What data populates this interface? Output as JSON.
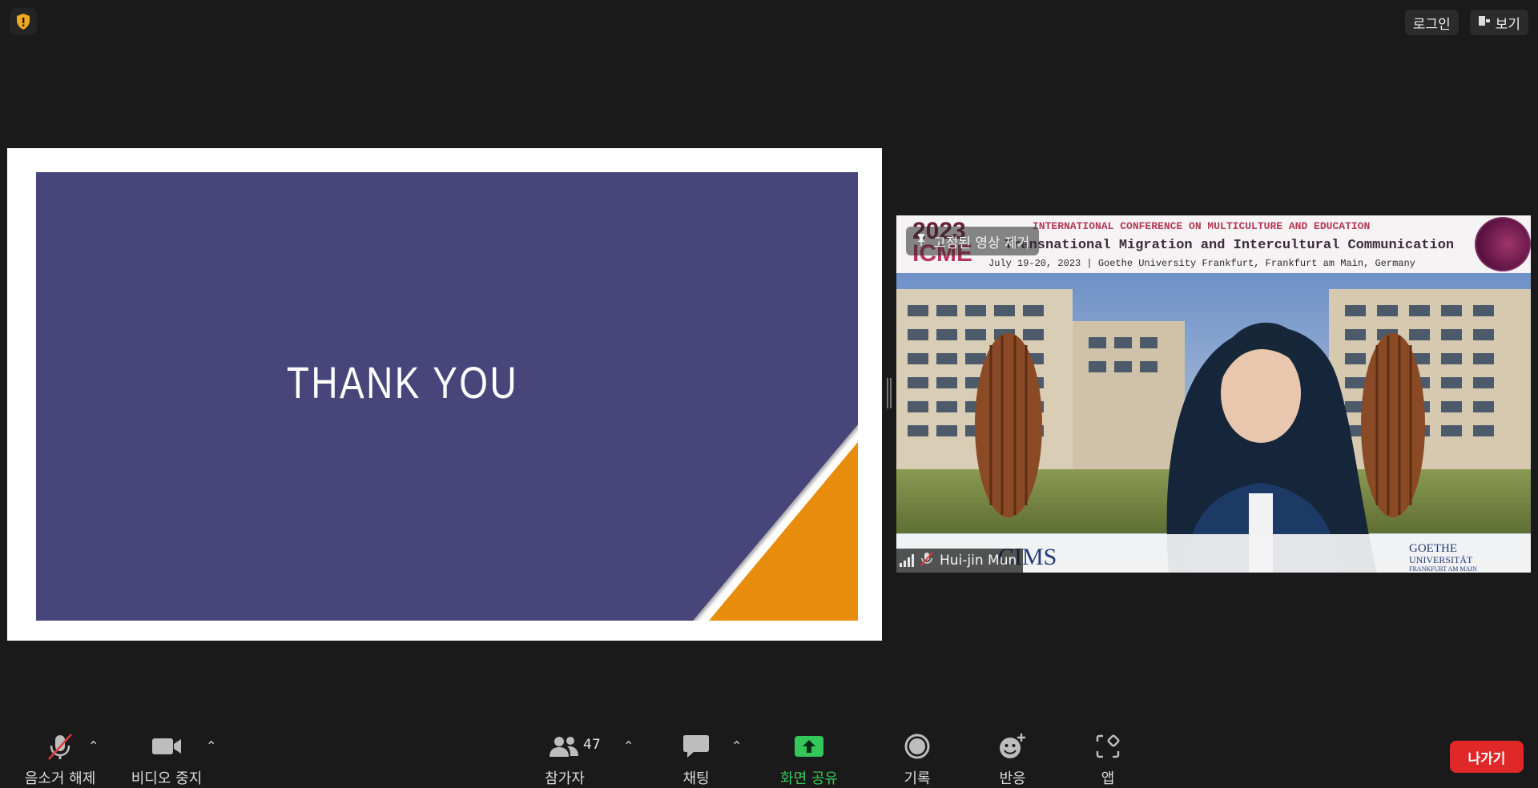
{
  "top": {
    "login": "로그인",
    "view": "보기"
  },
  "slide": {
    "title": "THANK YOU"
  },
  "video": {
    "banner_year": "2023",
    "banner_name": "ICME",
    "banner_line1": "INTERNATIONAL CONFERENCE ON MULTICULTURE AND EDUCATION",
    "banner_line2": "Transnational Migration and Intercultural Communication",
    "banner_line3": "July 19-20, 2023 | Goethe University Frankfurt, Frankfurt am Main, Germany",
    "unpin_label": "고정된 영상 제거",
    "participant_name": "Hui-jin Mun",
    "logo_cims": "CIMS",
    "logo_goethe": "GOETHE",
    "logo_universitat": "UNIVERSITÄT",
    "logo_frankfurt": "FRANKFURT AM MAIN"
  },
  "toolbar": {
    "unmute": "음소거 해제",
    "stop_video": "비디오 중지",
    "participants": "참가자",
    "participant_count": "47",
    "chat": "채팅",
    "share_screen": "화면 공유",
    "record": "기록",
    "reactions": "반응",
    "apps": "앱",
    "leave": "나가기"
  },
  "colors": {
    "slide_purple": "#46457a",
    "slide_orange": "#e88c0c",
    "share_green": "#34c759",
    "leave_red": "#e02828"
  }
}
